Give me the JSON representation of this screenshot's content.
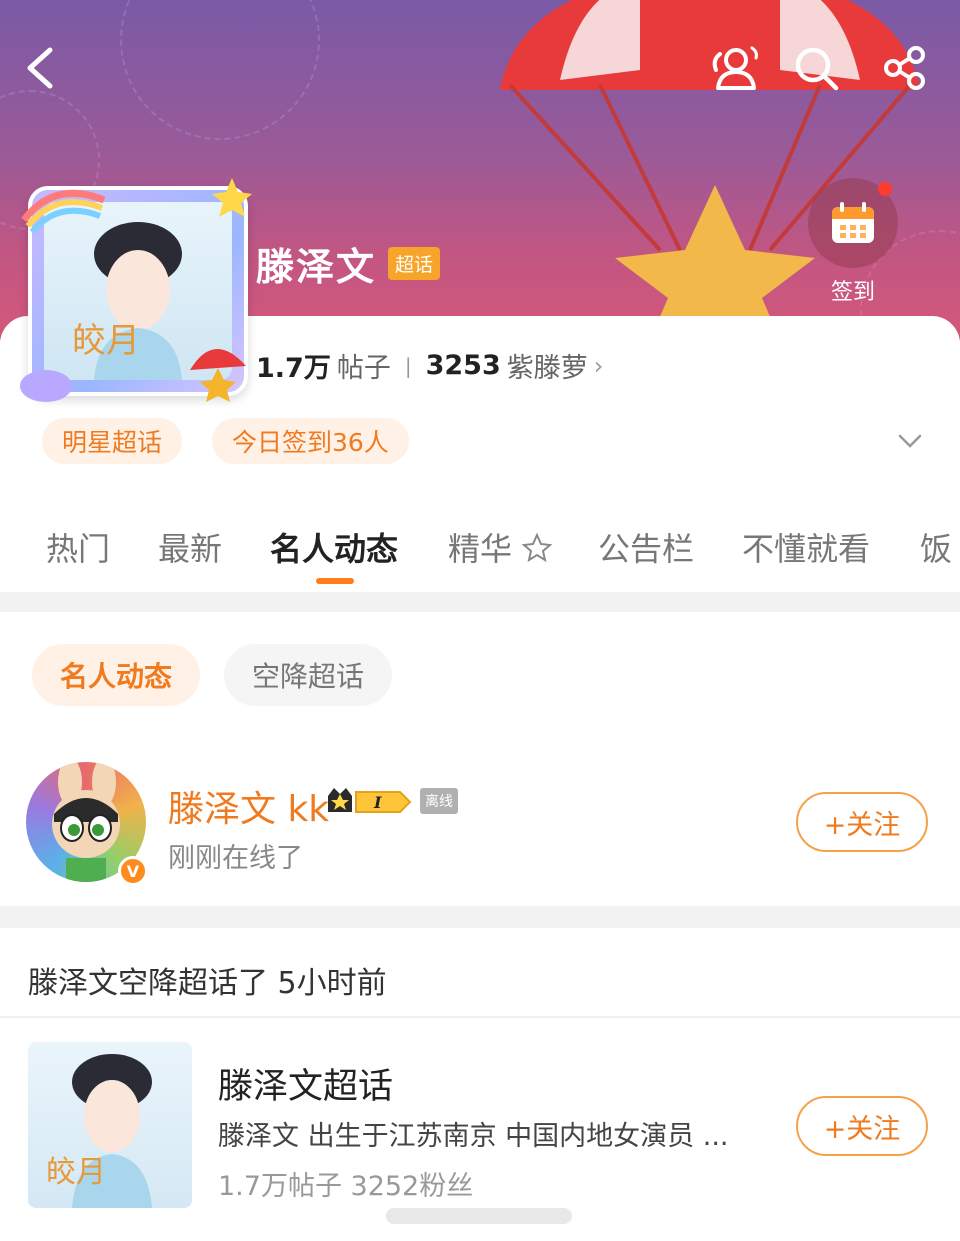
{
  "header": {
    "checkin_label": "签到",
    "colors": {
      "banner_top": "#7a5aa6",
      "banner_bottom": "#d4587a"
    }
  },
  "community": {
    "name": "滕泽文",
    "tag": "超话",
    "posts_count": "1.7万",
    "posts_label": "帖子",
    "fans_count": "3253",
    "fans_label": "紫滕萝",
    "chevron": "›",
    "pills": [
      "明星超话",
      "今日签到36人"
    ]
  },
  "tabs": [
    "热门",
    "最新",
    "名人动态",
    "精华",
    "公告栏",
    "不懂就看",
    "饭"
  ],
  "active_tab": "名人动态",
  "subtabs": [
    "名人动态",
    "空降超话"
  ],
  "user": {
    "name": "滕泽文 kk",
    "offline_tag": "离线",
    "status": "刚刚在线了",
    "follow_label": "+关注",
    "verified_badge": "V"
  },
  "event": {
    "text": "滕泽文空降超话了  5小时前",
    "topic_title": "滕泽文超话",
    "topic_desc": "滕泽文  出生于江苏南京  中国内地女演员 ...",
    "topic_stats": "1.7万帖子   3252粉丝",
    "follow_label": "+关注"
  },
  "accent_color": "#f07a1f"
}
